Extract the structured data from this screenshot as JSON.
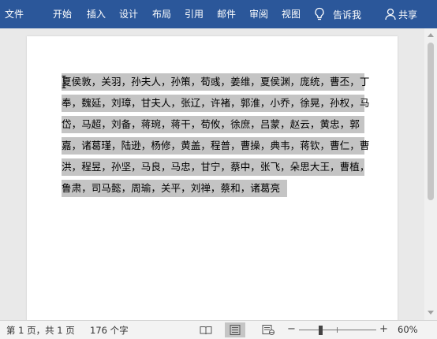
{
  "ribbon": {
    "tabs": [
      "文件",
      "开始",
      "插入",
      "设计",
      "布局",
      "引用",
      "邮件",
      "审阅",
      "视图"
    ],
    "tell_me": "告诉我",
    "share": "共享"
  },
  "document": {
    "lines": [
      "夏侯敦，关羽，孙夫人，孙策，荀彧，姜维，夏侯渊，庞统，曹丕，丁",
      "奉，魏延，刘璋，甘夫人，张辽，许褚，郭淮，小乔，徐晃，孙权，马",
      "岱，马超，刘备，蒋琬，蒋干，荀攸，徐庶，吕蒙，赵云，黄忠，郭",
      "嘉，诸葛瑾，陆逊，杨修，黄盖，程普，曹操，典韦，蒋钦，曹仁，曹",
      "洪，程昱，孙坚，马良，马忠，甘宁，蔡中，张飞，朵思大王，曹植，",
      "鲁肃，司马懿，周瑜，关平，刘禅，蔡和，诸葛亮"
    ],
    "selected": true
  },
  "status": {
    "pages": "第 1 页，共 1 页",
    "words": "176 个字",
    "zoom": "60%",
    "zoom_minus": "−",
    "zoom_plus": "+",
    "active_view": "print-layout"
  }
}
